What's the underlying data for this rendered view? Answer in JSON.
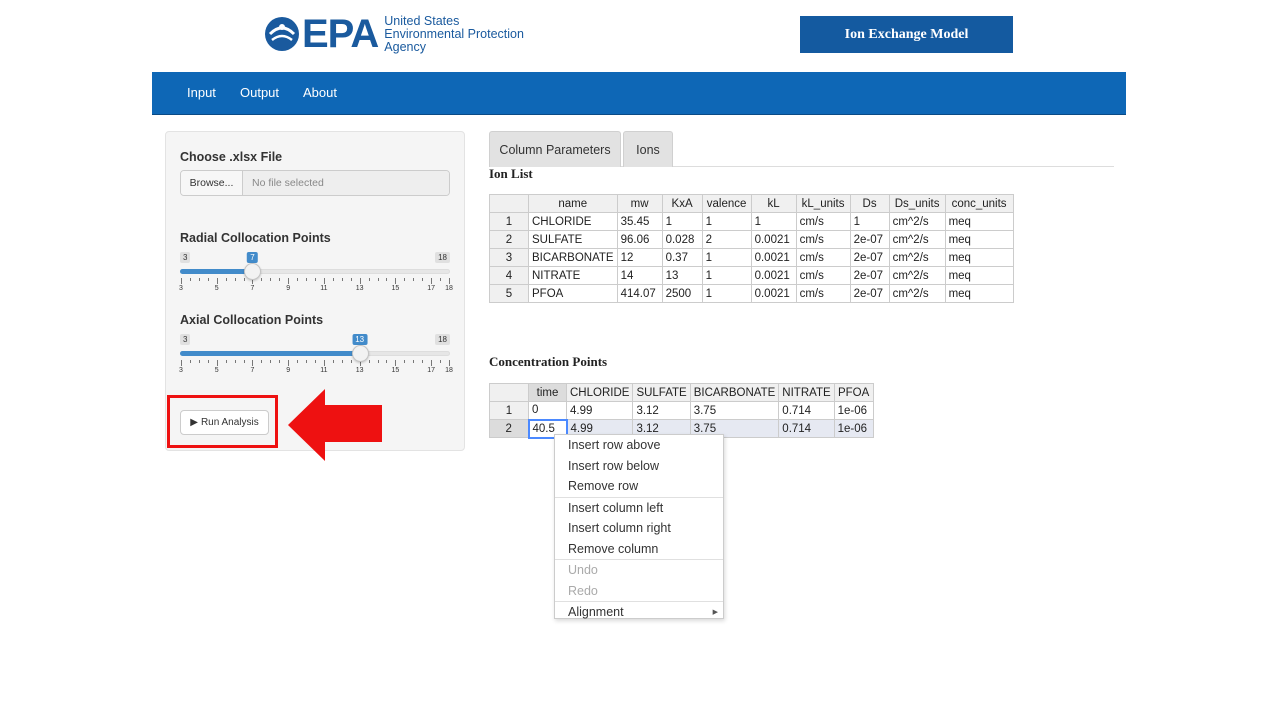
{
  "header": {
    "logo_word": "EPA",
    "agency_lines": [
      "United States",
      "Environmental Protection",
      "Agency"
    ],
    "app_title": "Ion Exchange Model"
  },
  "navbar": {
    "items": [
      "Input",
      "Output",
      "About"
    ]
  },
  "sidebar": {
    "file_label": "Choose .xlsx File",
    "browse_label": "Browse...",
    "file_placeholder": "No file selected",
    "radial": {
      "label": "Radial Collocation Points",
      "min": 3,
      "max": 18,
      "value": 7,
      "tick_labels": [
        "3",
        "5",
        "7",
        "9",
        "11",
        "13",
        "15",
        "17",
        "18"
      ]
    },
    "axial": {
      "label": "Axial Collocation Points",
      "min": 3,
      "max": 18,
      "value": 13,
      "tick_labels": [
        "3",
        "5",
        "7",
        "9",
        "11",
        "13",
        "15",
        "17",
        "18"
      ]
    },
    "run_label": "Run Analysis",
    "run_icon": "play-icon"
  },
  "tabs": [
    "Column Parameters",
    "Ions"
  ],
  "ion_list": {
    "title": "Ion List",
    "headers": [
      "name",
      "mw",
      "KxA",
      "valence",
      "kL",
      "kL_units",
      "Ds",
      "Ds_units",
      "conc_units"
    ],
    "rows": [
      [
        "1",
        "CHLORIDE",
        "35.45",
        "1",
        "1",
        "1",
        "cm/s",
        "1",
        "cm^2/s",
        "meq"
      ],
      [
        "2",
        "SULFATE",
        "96.06",
        "0.028",
        "2",
        "0.0021",
        "cm/s",
        "2e-07",
        "cm^2/s",
        "meq"
      ],
      [
        "3",
        "BICARBONATE",
        "12",
        "0.37",
        "1",
        "0.0021",
        "cm/s",
        "2e-07",
        "cm^2/s",
        "meq"
      ],
      [
        "4",
        "NITRATE",
        "14",
        "13",
        "1",
        "0.0021",
        "cm/s",
        "2e-07",
        "cm^2/s",
        "meq"
      ],
      [
        "5",
        "PFOA",
        "414.07",
        "2500",
        "1",
        "0.0021",
        "cm/s",
        "2e-07",
        "cm^2/s",
        "meq"
      ]
    ]
  },
  "concentration": {
    "title": "Concentration Points",
    "headers": [
      "time",
      "CHLORIDE",
      "SULFATE",
      "BICARBONATE",
      "NITRATE",
      "PFOA"
    ],
    "rows": [
      [
        "1",
        "0",
        "4.99",
        "3.12",
        "3.75",
        "0.714",
        "1e-06"
      ],
      [
        "2",
        "40.5",
        "4.99",
        "3.12",
        "3.75",
        "0.714",
        "1e-06"
      ]
    ]
  },
  "context_menu": {
    "items": [
      {
        "label": "Insert row above",
        "disabled": false
      },
      {
        "label": "Insert row below",
        "disabled": false
      },
      {
        "label": "Remove row",
        "disabled": false
      },
      {
        "label": "Insert column left",
        "disabled": false
      },
      {
        "label": "Insert column right",
        "disabled": false
      },
      {
        "label": "Remove column",
        "disabled": false
      },
      {
        "label": "Undo",
        "disabled": true
      },
      {
        "label": "Redo",
        "disabled": true
      },
      {
        "label": "Alignment",
        "disabled": false,
        "submenu": true
      }
    ]
  },
  "colors": {
    "brand_blue": "#0e67b6",
    "title_box": "#145aa0",
    "slider_blue": "#428bca",
    "highlight_red": "#ee1111"
  }
}
